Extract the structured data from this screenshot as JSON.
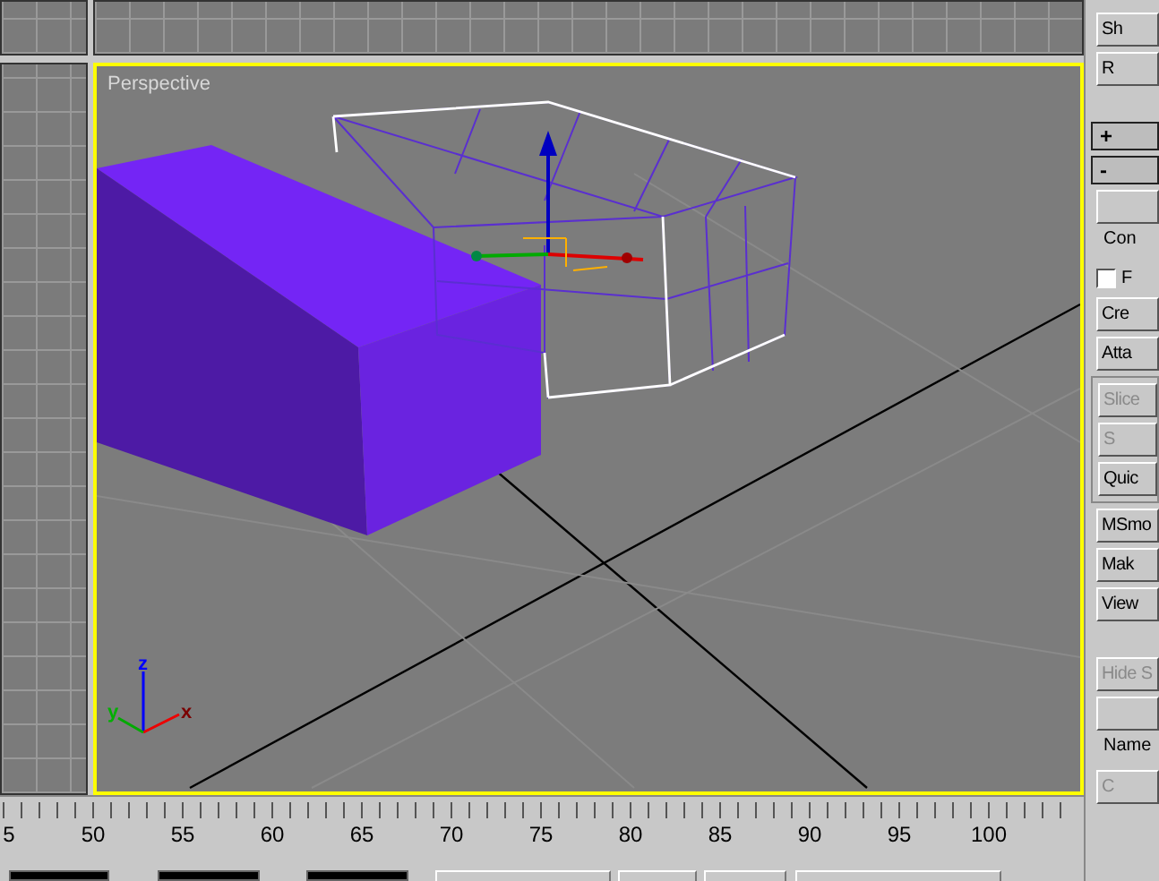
{
  "viewport": {
    "label": "Perspective",
    "active": true
  },
  "axis_tripod": {
    "x": "x",
    "y": "y",
    "z": "z"
  },
  "command_panel": {
    "items": [
      {
        "kind": "button",
        "label": "Sh",
        "disabled": false
      },
      {
        "kind": "button",
        "label": "R",
        "disabled": false
      },
      {
        "kind": "spacer"
      },
      {
        "kind": "rollout",
        "label": "+"
      },
      {
        "kind": "rollout",
        "label": "-"
      },
      {
        "kind": "button"
      },
      {
        "kind": "label",
        "label": "Con"
      },
      {
        "kind": "checkbox",
        "label": "F",
        "checked": false
      },
      {
        "kind": "button",
        "label": "Cre",
        "disabled": false
      },
      {
        "kind": "button",
        "label": "Atta",
        "disabled": false
      },
      {
        "kind": "group",
        "children": [
          {
            "kind": "button",
            "label": "Slice",
            "disabled": true
          },
          {
            "kind": "button",
            "label": "S",
            "disabled": true
          },
          {
            "kind": "button",
            "label": "Quic",
            "disabled": false
          }
        ]
      },
      {
        "kind": "button",
        "label": "MSmo",
        "disabled": false
      },
      {
        "kind": "button",
        "label": "Mak",
        "disabled": false
      },
      {
        "kind": "button",
        "label": "View",
        "disabled": false
      },
      {
        "kind": "spacer"
      },
      {
        "kind": "button",
        "label": "Hide S",
        "disabled": true
      },
      {
        "kind": "button"
      },
      {
        "kind": "label",
        "label": "Name"
      },
      {
        "kind": "button",
        "label": "C",
        "disabled": true
      }
    ]
  },
  "timeline": {
    "labels": [
      "5",
      "50",
      "55",
      "60",
      "65",
      "70",
      "75",
      "80",
      "85",
      "90",
      "95",
      "100"
    ]
  }
}
